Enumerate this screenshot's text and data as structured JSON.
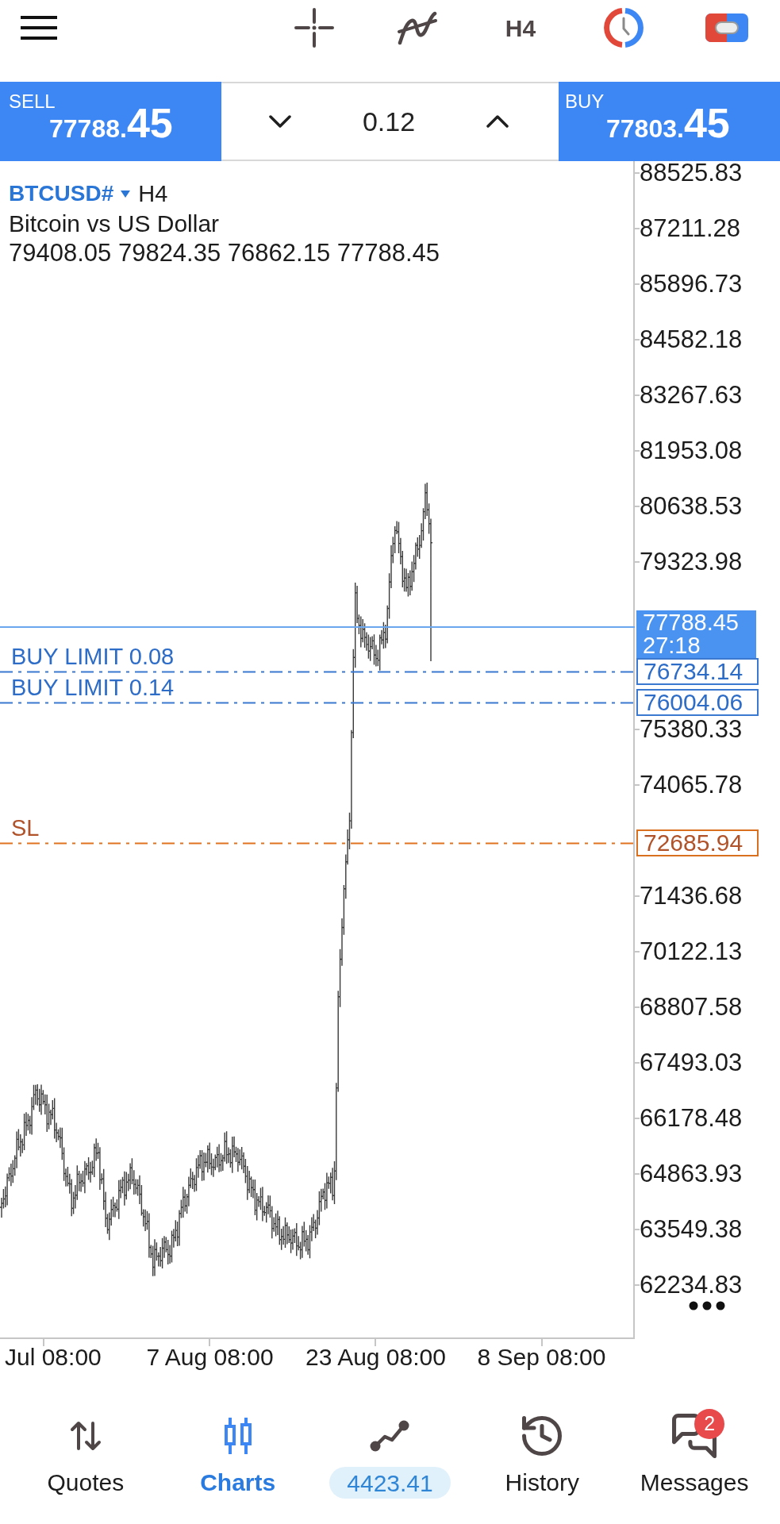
{
  "top_bar": {
    "timeframe": "H4"
  },
  "trade_bar": {
    "sell": {
      "label": "SELL",
      "price_main": "77788.",
      "price_pips": "45"
    },
    "volume": "0.12",
    "buy": {
      "label": "BUY",
      "price_main": "77803.",
      "price_pips": "45"
    }
  },
  "chart": {
    "symbol": "BTCUSD#",
    "timeframe": "H4",
    "description": "Bitcoin vs US Dollar",
    "ohlc": "79408.05 79824.35 76862.15 77788.45",
    "price_axis": [
      "88525.83",
      "87211.28",
      "85896.73",
      "84582.18",
      "83267.63",
      "81953.08",
      "80638.53",
      "79323.98",
      "75380.33",
      "74065.78",
      "71436.68",
      "70122.13",
      "68807.58",
      "67493.03",
      "66178.48",
      "64863.93",
      "63549.38",
      "62234.83"
    ],
    "current_price": {
      "price": "77788.45",
      "countdown": "27:18"
    },
    "orders": [
      {
        "kind": "buy_limit",
        "label": "BUY LIMIT 0.08",
        "price": "76734.14"
      },
      {
        "kind": "buy_limit",
        "label": "BUY LIMIT 0.14",
        "price": "76004.06"
      },
      {
        "kind": "stop_loss",
        "label": "SL",
        "price": "72685.94"
      }
    ],
    "time_axis": [
      "Jul 08:00",
      "7 Aug 08:00",
      "23 Aug 08:00",
      "8 Sep 08:00"
    ]
  },
  "nav": [
    {
      "kind": "tab",
      "label": "Quotes",
      "selected": false
    },
    {
      "kind": "tab",
      "label": "Charts",
      "selected": true
    },
    {
      "kind": "balance",
      "label": "4423.41",
      "selected": false
    },
    {
      "kind": "tab",
      "label": "History",
      "selected": false
    },
    {
      "kind": "tab",
      "label": "Messages",
      "selected": false,
      "badge": "2"
    }
  ]
}
